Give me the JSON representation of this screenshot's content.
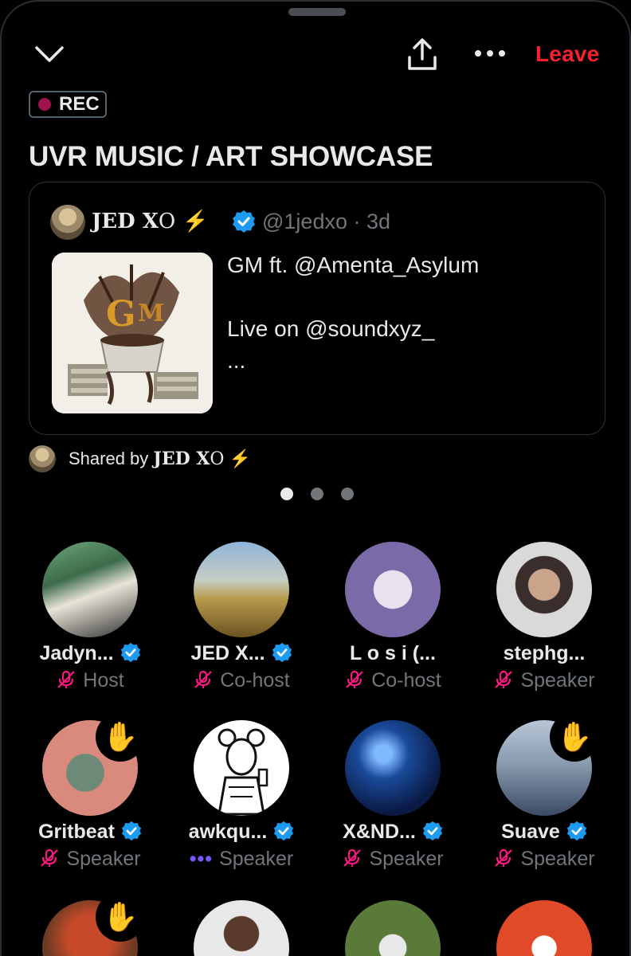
{
  "header": {
    "leave_label": "Leave"
  },
  "recording_badge": "REC",
  "space_title": "UVR MUSIC / ART SHOWCASE",
  "pinned_post": {
    "author_name": "JED X",
    "author_ring": "O",
    "author_emoji": "⚡",
    "handle": "@1jedxo · 3d",
    "lines": [
      "GM ft. @Amenta_Asylum",
      "",
      "Live on @soundxyz_",
      "..."
    ]
  },
  "shared_by": {
    "prefix": "Shared by",
    "name": "JED X",
    "ring": "O",
    "emoji": "⚡"
  },
  "participants": [
    {
      "name": "Jadyn...",
      "verified": true,
      "role": "Host",
      "muted": true,
      "hand": false
    },
    {
      "name": "JED X...",
      "verified": true,
      "role": "Co-host",
      "muted": true,
      "hand": false
    },
    {
      "name": "L o s i (...",
      "verified": false,
      "role": "Co-host",
      "muted": true,
      "hand": false
    },
    {
      "name": "stephg...",
      "verified": false,
      "role": "Speaker",
      "muted": true,
      "hand": false
    },
    {
      "name": "Gritbeat",
      "verified": true,
      "role": "Speaker",
      "muted": true,
      "hand": true
    },
    {
      "name": "awkqu...",
      "verified": true,
      "role": "Speaker",
      "muted": false,
      "hand": false
    },
    {
      "name": "X&ND...",
      "verified": true,
      "role": "Speaker",
      "muted": true,
      "hand": false
    },
    {
      "name": "Suave",
      "verified": true,
      "role": "Speaker",
      "muted": true,
      "hand": true
    }
  ],
  "speaking_indicator": "•••",
  "hand_emoji": "✋",
  "colors": {
    "accent_red": "#f4212e",
    "verified_blue": "#1d9bf0",
    "muted_pink": "#f91880",
    "speaking_purple": "#7856ff"
  }
}
